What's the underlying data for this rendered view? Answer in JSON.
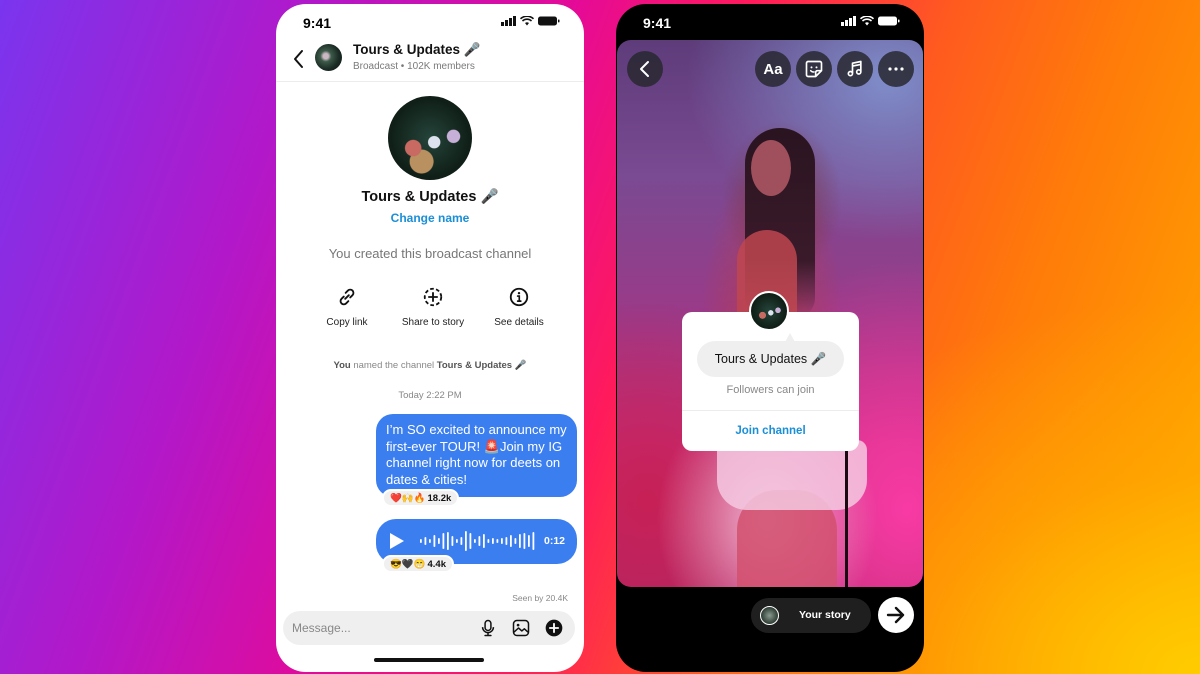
{
  "left_phone": {
    "status_bar": {
      "time": "9:41"
    },
    "header": {
      "back_icon": "chevron-left-icon",
      "title": "Tours & Updates 🎤",
      "subtitle": "Broadcast • 102K members"
    },
    "channel": {
      "name": "Tours & Updates 🎤",
      "change_name_label": "Change name",
      "created_note": "You created this broadcast channel"
    },
    "actions": [
      {
        "icon": "link-icon",
        "label": "Copy link"
      },
      {
        "icon": "add-to-story-icon",
        "label": "Share to story"
      },
      {
        "icon": "info-icon",
        "label": "See details"
      }
    ],
    "system_note": {
      "actor": "You",
      "text": " named the channel ",
      "channel": "Tours & Updates 🎤"
    },
    "timestamp": "Today 2:22 PM",
    "messages": [
      {
        "type": "text",
        "text": "I’m SO excited to announce my first-ever TOUR! 🚨Join my IG channel right now for deets on dates & cities!",
        "reactions": "❤️🙌🔥",
        "reaction_count": "18.2k"
      },
      {
        "type": "voice",
        "duration": "0:12",
        "reactions": "😎🖤😁",
        "reaction_count": "4.4k"
      }
    ],
    "seen_by": "Seen by 20.4K",
    "composer": {
      "placeholder": "Message...",
      "icons": [
        "microphone-icon",
        "gallery-icon",
        "plus-circle-icon"
      ]
    },
    "accent_color": "#3b7ef0",
    "link_color": "#1a8fd8"
  },
  "right_phone": {
    "status_bar": {
      "time": "9:41"
    },
    "toolbar": {
      "back_icon": "chevron-left-icon",
      "text_tool_label": "Aa",
      "tools": [
        "text-icon",
        "sticker-icon",
        "music-icon",
        "more-icon"
      ]
    },
    "sticker": {
      "channel_name": "Tours & Updates 🎤",
      "subtitle": "Followers can join",
      "join_label": "Join channel"
    },
    "footer": {
      "your_story_label": "Your story",
      "next_icon": "arrow-right-icon"
    }
  }
}
